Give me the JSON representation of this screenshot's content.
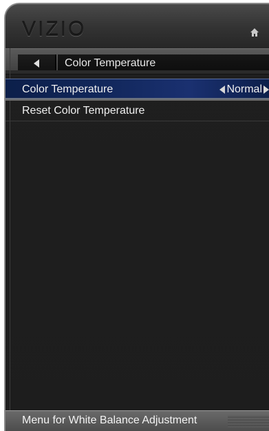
{
  "header": {
    "logo": "VIZIO",
    "home_icon": "home-icon"
  },
  "nav": {
    "back_icon": "back-triangle-icon",
    "title": "Color Temperature"
  },
  "menu": {
    "items": [
      {
        "label": "Color Temperature",
        "value": "Normal",
        "selected": true
      },
      {
        "label": "Reset Color Temperature",
        "selected": false
      }
    ]
  },
  "status": {
    "text": "Menu for White Balance Adjustment"
  },
  "colors": {
    "selected_highlight": "#11275a",
    "panel_background": "#1d1d1d",
    "text": "#f0f0f0"
  }
}
